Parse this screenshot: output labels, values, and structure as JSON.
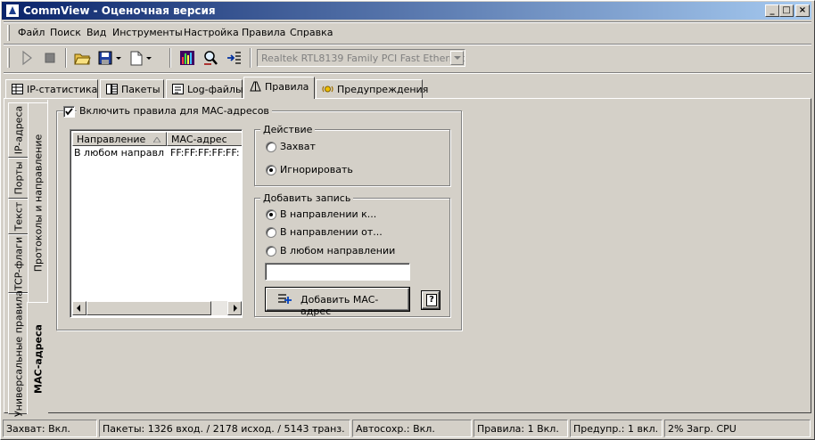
{
  "window": {
    "title": "CommView - Оценочная версия",
    "caption_buttons": {
      "minimize": "_",
      "maximize": "□",
      "close": "×"
    }
  },
  "menu": {
    "items": [
      "Файл",
      "Поиск",
      "Вид",
      "Инструменты",
      "Настройка",
      "Правила",
      "Справка"
    ]
  },
  "toolbar": {
    "adapter": "Realtek RTL8139 Family PCI Fast Ethernet NIC",
    "icons": [
      "play-icon",
      "stop-icon",
      "open-folder-icon",
      "save-icon",
      "new-document-icon",
      "stats-icon",
      "search-icon",
      "import-icon"
    ]
  },
  "tabs": [
    {
      "label": "IP-статистика",
      "icon": "table-icon"
    },
    {
      "label": "Пакеты",
      "icon": "packets-icon"
    },
    {
      "label": "Log-файлы",
      "icon": "log-icon"
    },
    {
      "label": "Правила",
      "icon": "rules-icon"
    },
    {
      "label": "Предупреждения",
      "icon": "alerts-icon"
    }
  ],
  "vertical_tabs_outer": [
    "IP-адреса",
    "Порты",
    "Текст",
    "TCP-флаги",
    "Универсальные правила",
    "MAC-адреса"
  ],
  "vertical_tabs_inner": [
    "Протоколы и направление"
  ],
  "mac_rules": {
    "enable_label": "Включить правила для MAC-адресов",
    "enabled": true,
    "columns": [
      "Направление",
      "MAC-адрес"
    ],
    "rows": [
      {
        "direction": "В любом направл...",
        "mac": "FF:FF:FF:FF:FF:"
      }
    ],
    "action": {
      "legend": "Действие",
      "options": [
        "Захват",
        "Игнорировать"
      ],
      "selected": "Игнорировать"
    },
    "add_record": {
      "legend": "Добавить запись",
      "options": [
        "В направлении к...",
        "В направлении от...",
        "В любом направлении"
      ],
      "selected": "В направлении к...",
      "mac_value": "",
      "add_button": "Добавить MAC-адрес",
      "help_button": "?"
    }
  },
  "status": {
    "capture": "Захват: Вкл.",
    "packets": "Пакеты: 1326 вход. / 2178 исход. / 5143 транз.",
    "autosave": "Автосохр.: Вкл.",
    "rules": "Правила: 1 Вкл.",
    "alerts": "Предупр.: 1 вкл.",
    "cpu": "2% Загр. CPU"
  }
}
